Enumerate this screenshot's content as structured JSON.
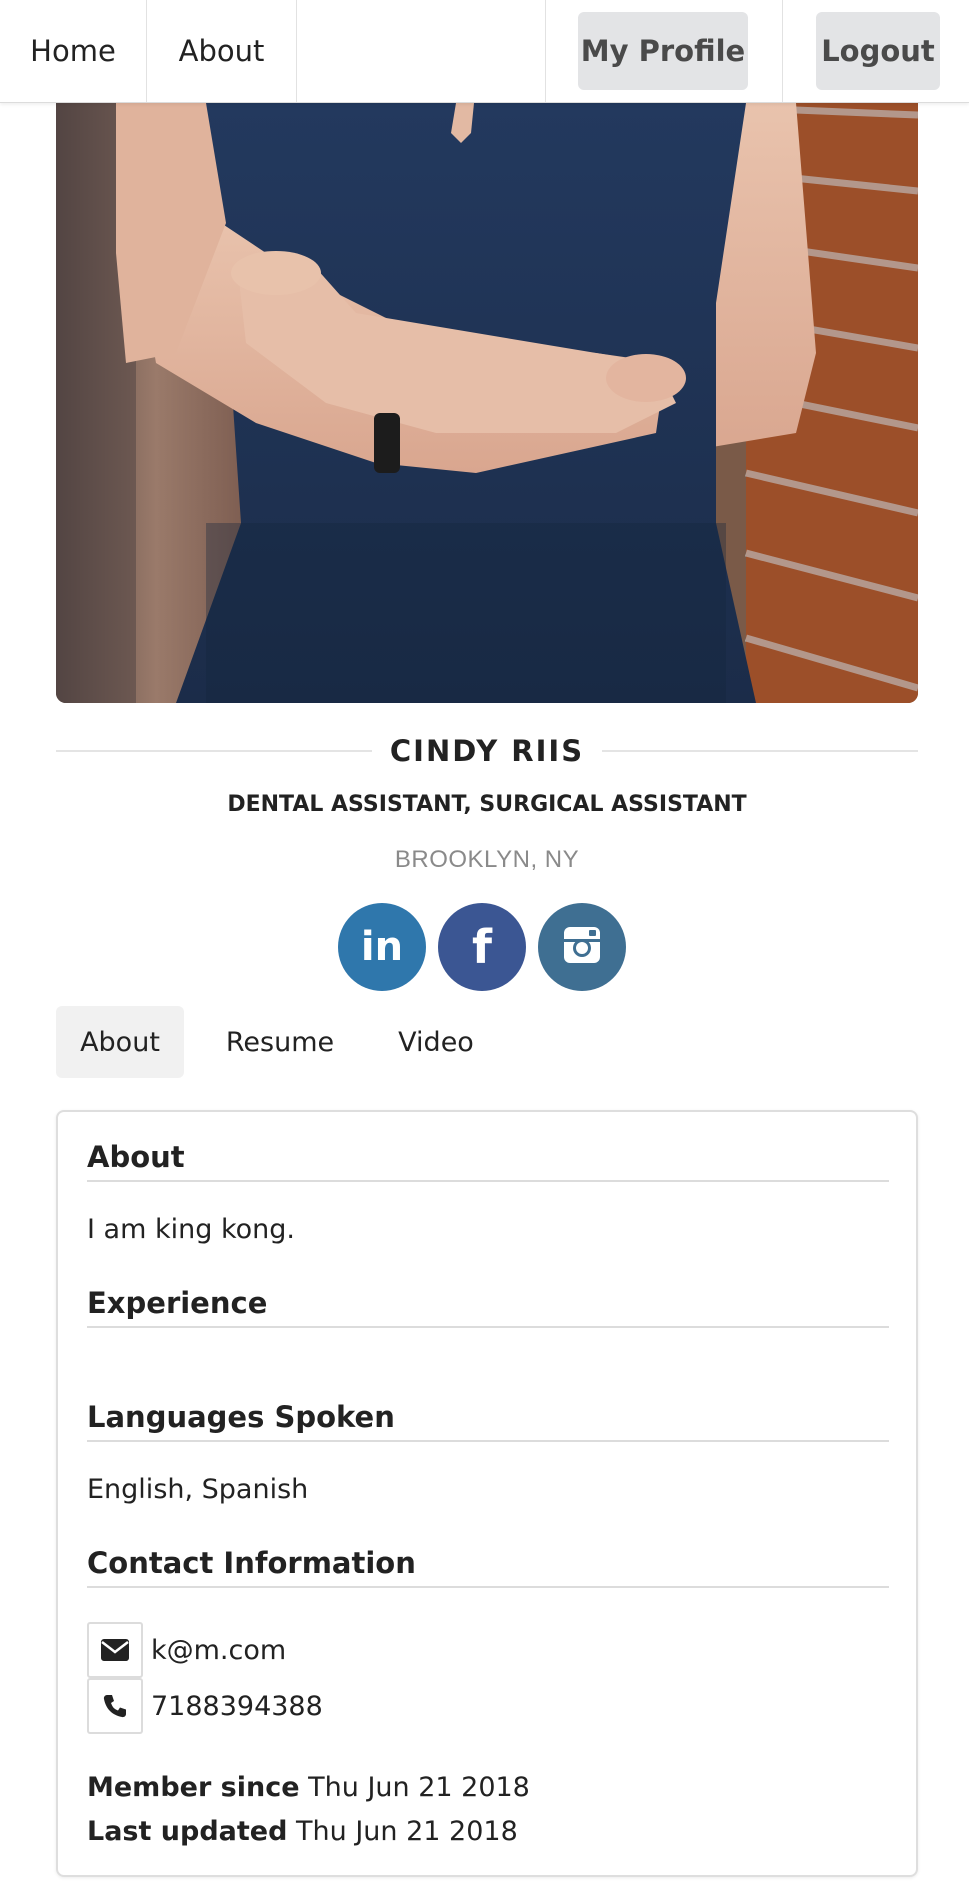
{
  "nav": {
    "home_label": "Home",
    "about_label": "About",
    "profile_label": "My Profile",
    "logout_label": "Logout"
  },
  "profile": {
    "name": "CINDY RIIS",
    "profession": "DENTAL ASSISTANT, SURGICAL ASSISTANT",
    "location": "BROOKLYN, NY"
  },
  "social": [
    {
      "icon": "linkedin-icon",
      "label": "in",
      "color": "#2f77ac"
    },
    {
      "icon": "facebook-icon",
      "label": "f",
      "color": "#3b5693"
    },
    {
      "icon": "instagram-icon",
      "color": "#3f6f92"
    }
  ],
  "tabs": [
    {
      "label": "About",
      "active": true
    },
    {
      "label": "Resume",
      "active": false
    },
    {
      "label": "Video",
      "active": false
    }
  ],
  "card": {
    "about_heading": "About",
    "about_text": "I am king kong.",
    "experience_heading": "Experience",
    "experience_text": "",
    "languages_heading": "Languages Spoken",
    "languages_text": "English, Spanish",
    "contact_heading": "Contact Information",
    "email": "k@m.com",
    "phone": "7188394388",
    "member_since_label": "Member since",
    "member_since_value": "Thu Jun 21 2018",
    "last_updated_label": "Last updated",
    "last_updated_value": "Thu Jun 21 2018"
  }
}
